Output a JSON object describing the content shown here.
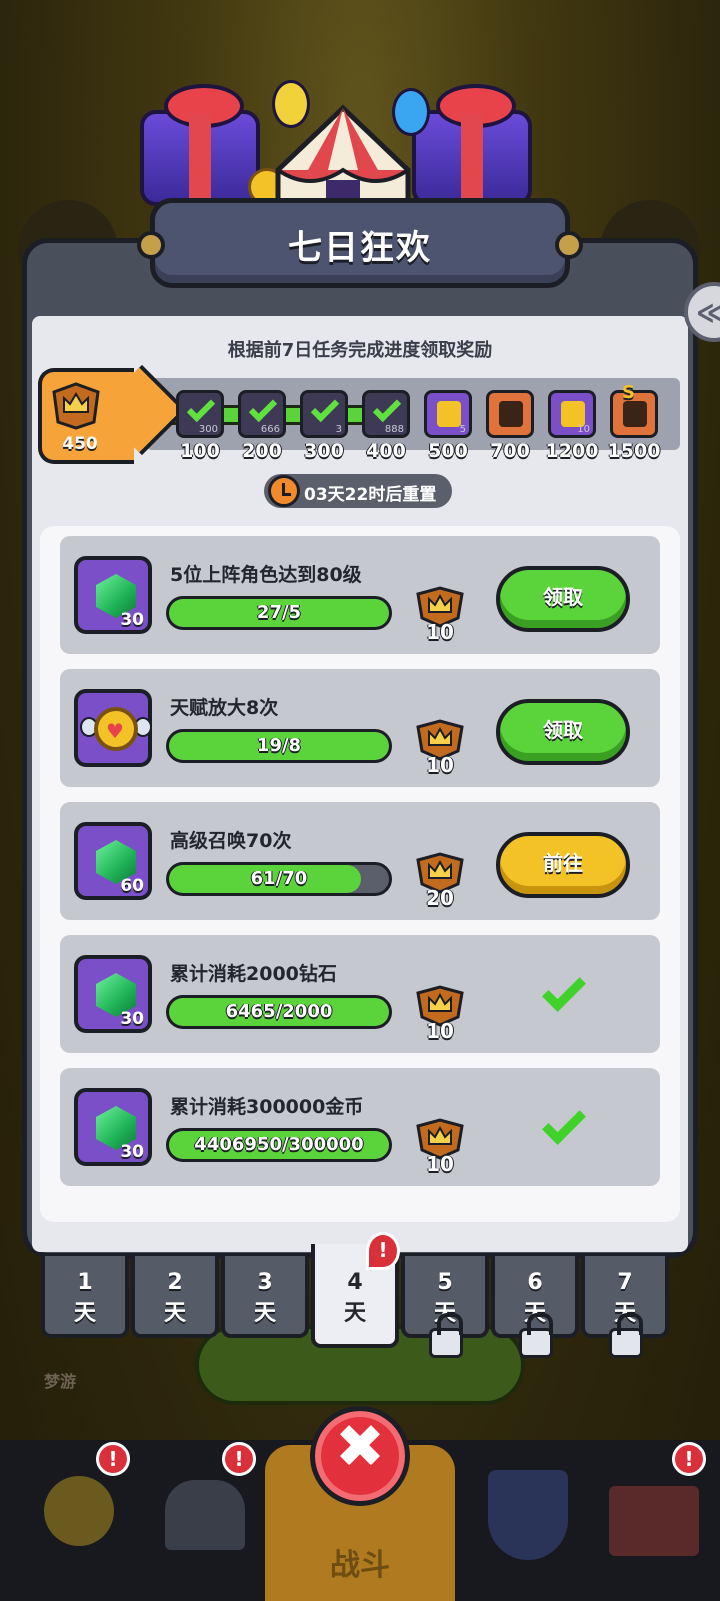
{
  "title": "七日狂欢",
  "subtitle": "根据前7日任务完成进度领取奖励",
  "score": "450",
  "milestones": [
    {
      "points": "100",
      "state": "claimed",
      "qty": "300"
    },
    {
      "points": "200",
      "state": "claimed",
      "qty": "666"
    },
    {
      "points": "300",
      "state": "claimed",
      "qty": "3"
    },
    {
      "points": "400",
      "state": "claimed",
      "qty": "888"
    },
    {
      "points": "500",
      "state": "locked",
      "reward": "hammer-icon",
      "qty": "5"
    },
    {
      "points": "700",
      "state": "locked",
      "reward": "hero-portrait"
    },
    {
      "points": "1200",
      "state": "locked",
      "reward": "key-icon",
      "qty": "10"
    },
    {
      "points": "1500",
      "state": "locked",
      "reward": "hero-portrait",
      "grade": "S"
    }
  ],
  "score_progress_fraction": 0.44,
  "timer": "03天22时后重置",
  "tasks": [
    {
      "name": "5位上阵角色达到80级",
      "reward_icon": "gem-icon",
      "reward_count": "30",
      "progress": "27/5",
      "fill": 1.0,
      "points": "10",
      "action": "领取",
      "status": "claimable"
    },
    {
      "name": "天赋放大8次",
      "reward_icon": "talent-medal-icon",
      "reward_count": "",
      "progress": "19/8",
      "fill": 1.0,
      "points": "10",
      "action": "领取",
      "status": "claimable"
    },
    {
      "name": "高级召唤70次",
      "reward_icon": "gem-icon",
      "reward_count": "60",
      "progress": "61/70",
      "fill": 0.871,
      "points": "20",
      "action": "前往",
      "status": "in-progress"
    },
    {
      "name": "累计消耗2000钻石",
      "reward_icon": "gem-icon",
      "reward_count": "30",
      "progress": "6465/2000",
      "fill": 1.0,
      "points": "10",
      "action": "",
      "status": "claimed"
    },
    {
      "name": "累计消耗300000金币",
      "reward_icon": "gem-icon",
      "reward_count": "30",
      "progress": "4406950/300000",
      "fill": 1.0,
      "points": "10",
      "action": "",
      "status": "claimed"
    }
  ],
  "days": [
    {
      "num": "1",
      "unit": "天",
      "locked": false
    },
    {
      "num": "2",
      "unit": "天",
      "locked": false
    },
    {
      "num": "3",
      "unit": "天",
      "locked": false
    },
    {
      "num": "4",
      "unit": "天",
      "locked": false,
      "active": true
    },
    {
      "num": "5",
      "unit": "天",
      "locked": true
    },
    {
      "num": "6",
      "unit": "天",
      "locked": true
    },
    {
      "num": "7",
      "unit": "天",
      "locked": true
    }
  ],
  "alert_mark": "!",
  "close_label": "✖",
  "side_tab_glyph": "≪",
  "background": {
    "battle_label": "战斗",
    "tag": "梦游"
  },
  "colors": {
    "progress_green": "#5bd33a",
    "claim_green": "#5bd33a",
    "go_yellow": "#f2c227",
    "reward_purple": "#7a4fc8",
    "close_red": "#e2303c"
  }
}
